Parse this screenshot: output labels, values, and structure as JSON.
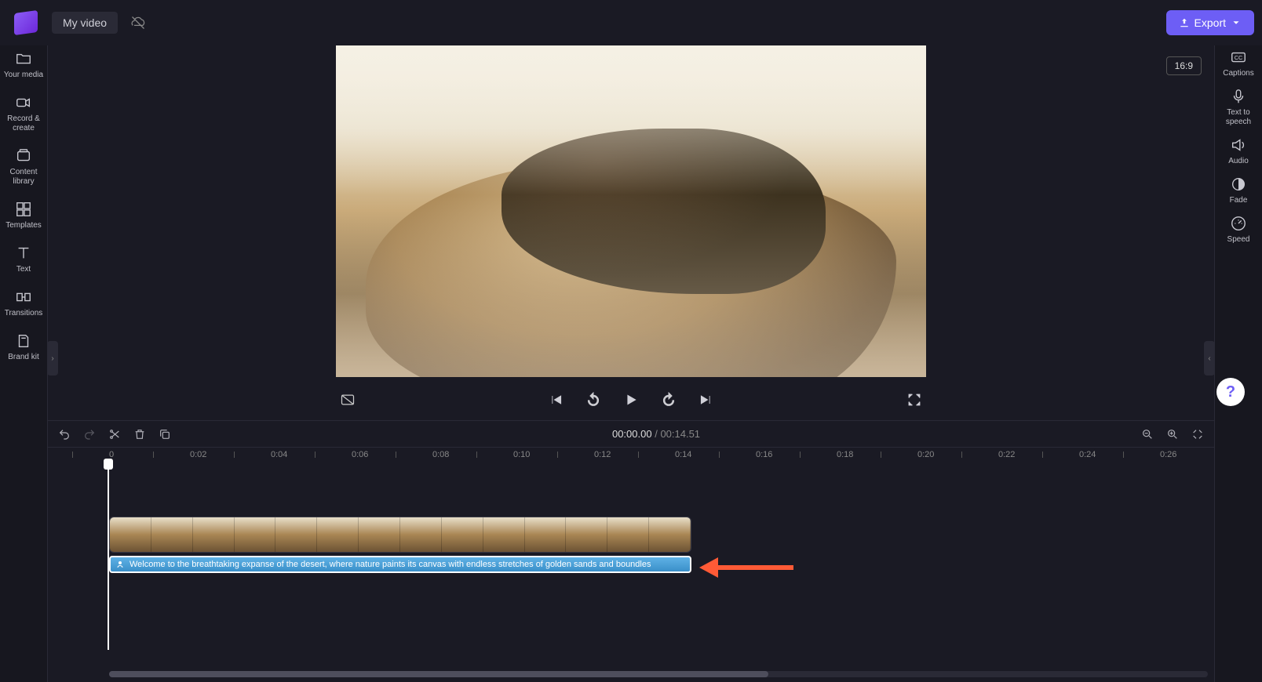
{
  "header": {
    "project_name": "My video",
    "export_label": "Export"
  },
  "left_rail": {
    "items": [
      {
        "label": "Your media",
        "name": "your-media"
      },
      {
        "label": "Record & create",
        "name": "record-create"
      },
      {
        "label": "Content library",
        "name": "content-library"
      },
      {
        "label": "Templates",
        "name": "templates"
      },
      {
        "label": "Text",
        "name": "text"
      },
      {
        "label": "Transitions",
        "name": "transitions"
      },
      {
        "label": "Brand kit",
        "name": "brand-kit"
      }
    ]
  },
  "right_rail": {
    "items": [
      {
        "label": "Captions",
        "icon": "cc",
        "name": "captions"
      },
      {
        "label": "Text to speech",
        "icon": "tts",
        "name": "text-to-speech"
      },
      {
        "label": "Audio",
        "icon": "speaker",
        "name": "audio"
      },
      {
        "label": "Fade",
        "icon": "fade",
        "name": "fade"
      },
      {
        "label": "Speed",
        "icon": "gauge",
        "name": "speed"
      }
    ]
  },
  "preview": {
    "aspect_label": "16:9"
  },
  "transport": {
    "current_time": "00:00.00",
    "duration": "00:14.51"
  },
  "timeline": {
    "ticks": [
      "0",
      "0:02",
      "0:04",
      "0:06",
      "0:08",
      "0:10",
      "0:12",
      "0:14",
      "0:16",
      "0:18",
      "0:20",
      "0:22",
      "0:24",
      "0:26"
    ],
    "audio_clip_text": "Welcome to the breathtaking expanse of the desert, where nature paints its canvas with endless stretches of golden sands and boundles"
  },
  "help_label": "?"
}
